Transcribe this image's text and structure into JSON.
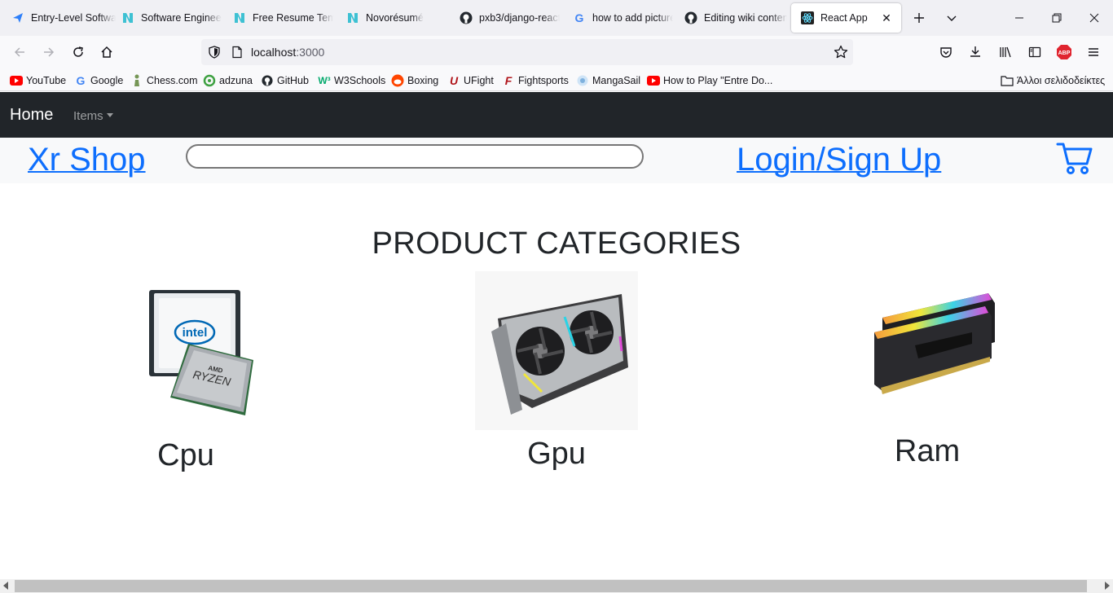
{
  "browser": {
    "tabs": [
      {
        "label": "Entry-Level Software",
        "icon": "paper-plane-icon",
        "active": false
      },
      {
        "label": "Software Engineer",
        "icon": "novoresume-icon",
        "active": false
      },
      {
        "label": "Free Resume Templates",
        "icon": "novoresume-icon",
        "active": false
      },
      {
        "label": "Novorésumé",
        "icon": "novoresume-icon",
        "active": false
      },
      {
        "label": "pxb3/django-react",
        "icon": "github-icon",
        "active": false
      },
      {
        "label": "how to add picture",
        "icon": "google-icon",
        "active": false
      },
      {
        "label": "Editing wiki content",
        "icon": "github-icon",
        "active": false
      },
      {
        "label": "React App",
        "icon": "react-icon",
        "active": true
      }
    ],
    "url_host": "localhost",
    "url_port": ":3000",
    "bookmarks": [
      {
        "label": "YouTube",
        "icon": "youtube-icon"
      },
      {
        "label": "Google",
        "icon": "google-icon"
      },
      {
        "label": "Chess.com",
        "icon": "chess-icon"
      },
      {
        "label": "adzuna",
        "icon": "adzuna-icon"
      },
      {
        "label": "GitHub",
        "icon": "github-icon"
      },
      {
        "label": "W3Schools",
        "icon": "w3schools-icon"
      },
      {
        "label": "Boxing",
        "icon": "reddit-icon"
      },
      {
        "label": "UFight",
        "icon": "ufight-icon"
      },
      {
        "label": "Fightsports",
        "icon": "fightsports-icon"
      },
      {
        "label": "MangaSail",
        "icon": "mangasail-icon"
      },
      {
        "label": "How to Play \"Entre Do...",
        "icon": "youtube-icon"
      }
    ],
    "other_bookmarks": "Άλλοι σελιδοδείκτες",
    "extension_badge": "ABP"
  },
  "app": {
    "nav": {
      "home": "Home",
      "items": "Items"
    },
    "brand": "Xr Shop",
    "search_value": "",
    "login": "Login/Sign Up",
    "heading": "PRODUCT CATEGORIES",
    "categories": [
      {
        "label": "Cpu",
        "brand_text_1": "intel",
        "brand_text_2": "AMD",
        "brand_text_3": "RYZEN"
      },
      {
        "label": "Gpu"
      },
      {
        "label": "Ram"
      }
    ]
  },
  "colors": {
    "link": "#0d6efd",
    "navbar": "#212529",
    "shopbar": "#f8f9fa"
  }
}
